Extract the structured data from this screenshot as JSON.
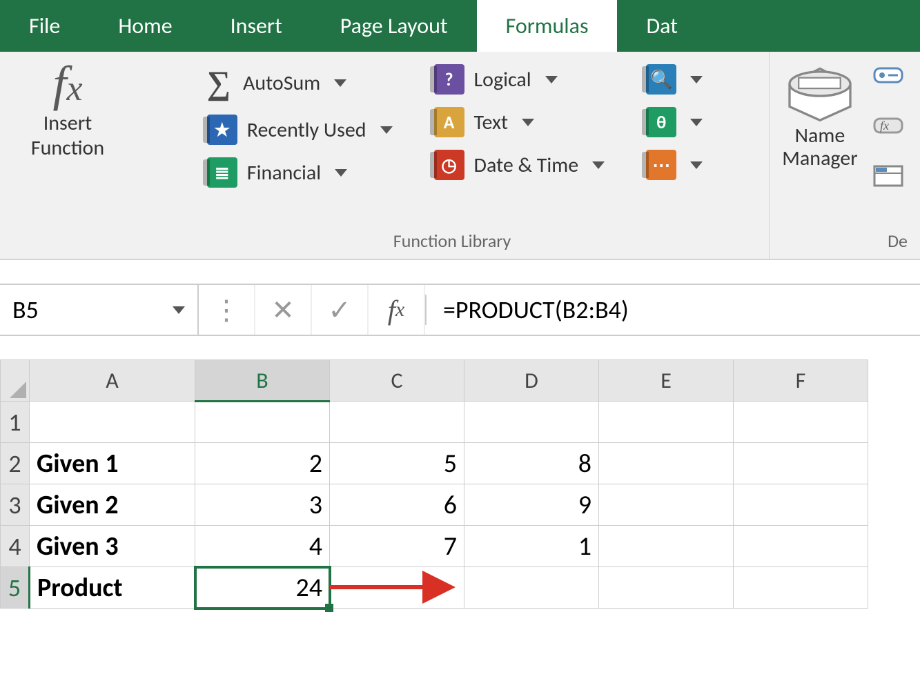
{
  "tabs": {
    "file": "File",
    "home": "Home",
    "insert": "Insert",
    "page_layout": "Page Layout",
    "formulas": "Formulas",
    "data": "Dat"
  },
  "ribbon": {
    "insert_function": {
      "label_line1": "Insert",
      "label_line2": "Function"
    },
    "library": {
      "autosum": "AutoSum",
      "recently_used": "Recently Used",
      "financial": "Financial",
      "logical": "Logical",
      "text": "Text",
      "date_time": "Date & Time",
      "group_label": "Function Library"
    },
    "name_manager": {
      "label_line1": "Name",
      "label_line2": "Manager"
    },
    "defined_names_label": "De"
  },
  "formula_bar": {
    "cell_ref": "B5",
    "formula": "=PRODUCT(B2:B4)"
  },
  "columns": [
    "A",
    "B",
    "C",
    "D",
    "E",
    "F"
  ],
  "row_numbers": [
    "1",
    "2",
    "3",
    "4",
    "5"
  ],
  "cells": {
    "A1": "",
    "B1": "",
    "C1": "",
    "D1": "",
    "E1": "",
    "F1": "",
    "A2": "Given 1",
    "B2": "2",
    "C2": "5",
    "D2": "8",
    "E2": "",
    "F2": "",
    "A3": "Given 2",
    "B3": "3",
    "C3": "6",
    "D3": "9",
    "E3": "",
    "F3": "",
    "A4": "Given 3",
    "B4": "4",
    "C4": "7",
    "D4": "1",
    "E4": "",
    "F4": "",
    "A5": "Product",
    "B5": "24",
    "C5": "",
    "D5": "",
    "E5": "",
    "F5": ""
  }
}
